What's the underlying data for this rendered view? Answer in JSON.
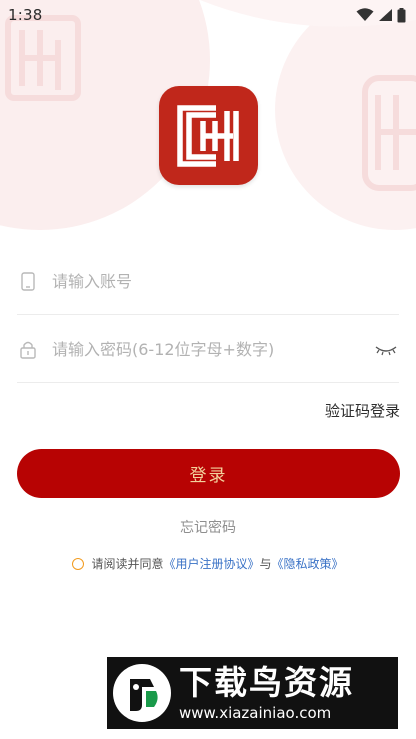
{
  "status_bar": {
    "time": "1:38",
    "icons": [
      "wifi-icon",
      "signal-icon",
      "battery-icon"
    ]
  },
  "app_logo": {
    "icon": "app-logo-icon",
    "color": "#c0271b"
  },
  "form": {
    "account_placeholder": "请输入账号",
    "password_placeholder": "请输入密码(6-12位字母+数字)",
    "account_icon": "phone-icon",
    "password_icon": "lock-icon",
    "toggle_icon": "eye-closed-icon"
  },
  "sms_login_label": "验证码登录",
  "login_button_label": "登录",
  "forgot_password_label": "忘记密码",
  "agreement": {
    "prefix": "请阅读并同意",
    "user_agreement": "《用户注册协议》",
    "and": "与",
    "privacy_policy": "《隐私政策》"
  },
  "watermark": {
    "title": "下载鸟资源",
    "url": "www.xiazainiao.com"
  },
  "colors": {
    "brand_red": "#b70303",
    "button_text": "#f3d19c",
    "link": "#3a72c6",
    "check_ring": "#f29b1f"
  }
}
